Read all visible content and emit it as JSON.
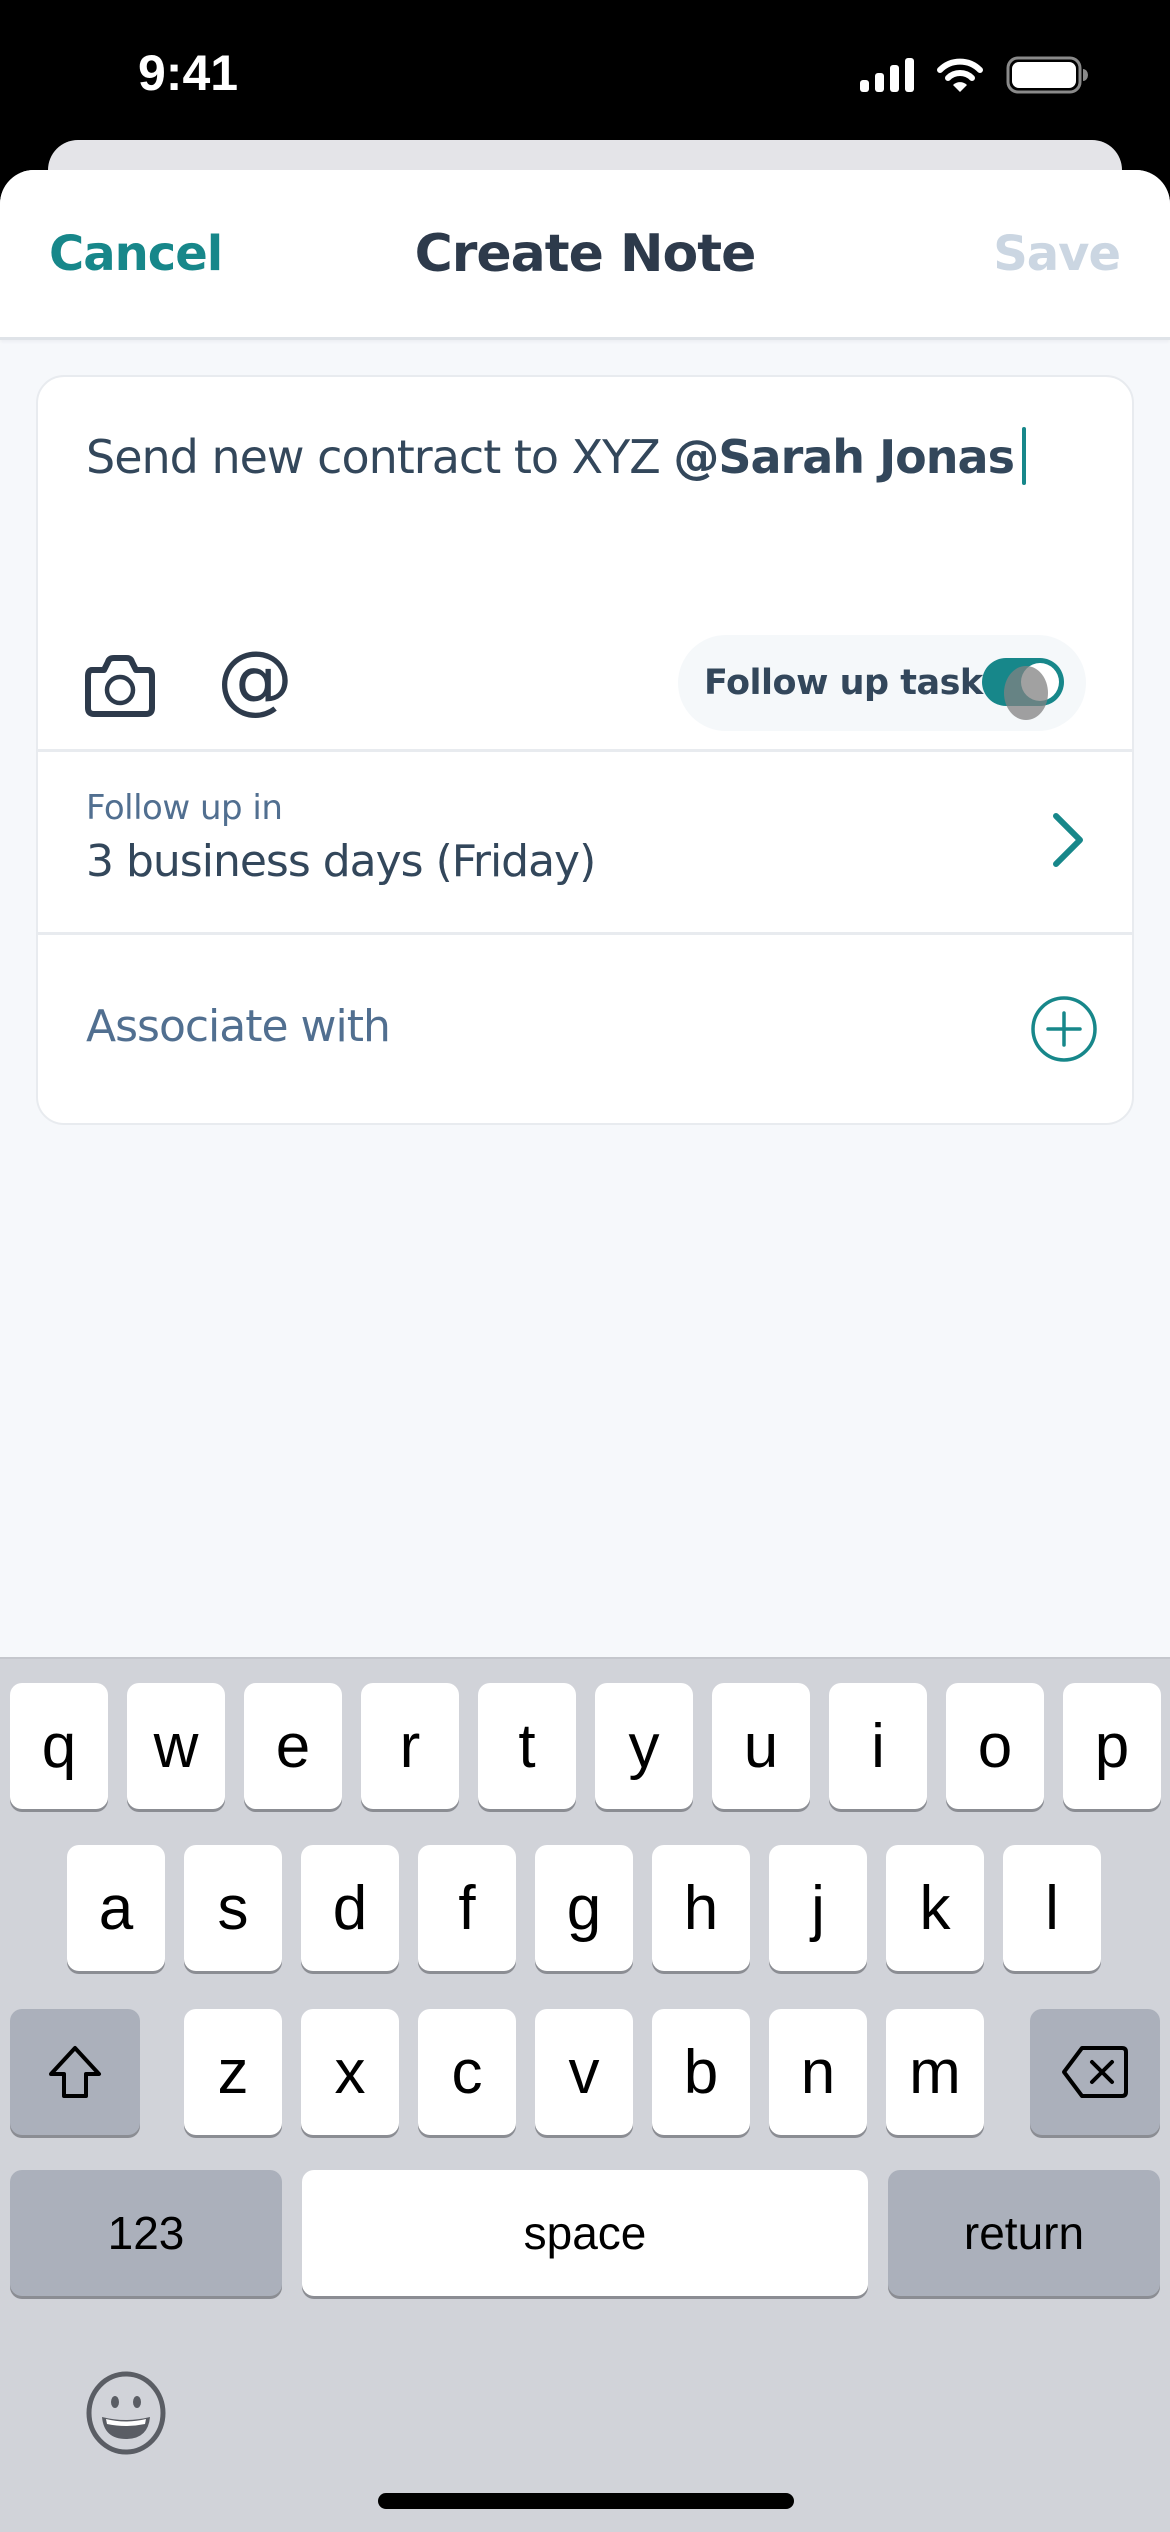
{
  "status_bar": {
    "time": "9:41",
    "icons": [
      "cellular-signal-icon",
      "wifi-icon",
      "battery-icon"
    ]
  },
  "nav": {
    "cancel_label": "Cancel",
    "title": "Create Note",
    "save_label": "Save"
  },
  "note": {
    "text_prefix": "Send new contract to XYZ ",
    "mention": "@Sarah Jonas",
    "tools": [
      "camera-icon",
      "at-mention-icon"
    ]
  },
  "follow_up_task": {
    "label": "Follow up task",
    "enabled": true
  },
  "follow_up_in": {
    "label": "Follow up in",
    "value": "3 business days (Friday)"
  },
  "associate": {
    "label": "Associate with"
  },
  "keyboard": {
    "row1": [
      "q",
      "w",
      "e",
      "r",
      "t",
      "y",
      "u",
      "i",
      "o",
      "p"
    ],
    "row2": [
      "a",
      "s",
      "d",
      "f",
      "g",
      "h",
      "j",
      "k",
      "l"
    ],
    "row3": [
      "z",
      "x",
      "c",
      "v",
      "b",
      "n",
      "m"
    ],
    "numbers_label": "123",
    "space_label": "space",
    "return_label": "return"
  },
  "colors": {
    "accent": "#17878a",
    "text_primary": "#33475b",
    "text_secondary": "#516f90",
    "save_disabled": "#cbd6e2",
    "background": "#f6f8fb",
    "keyboard_bg": "#d1d3d9"
  }
}
